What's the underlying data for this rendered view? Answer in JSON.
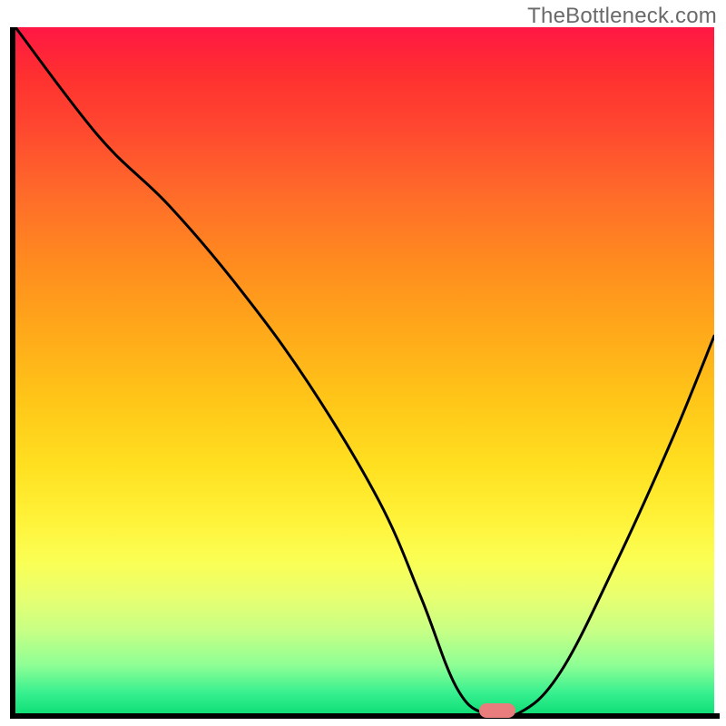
{
  "watermark": "TheBottleneck.com",
  "chart_data": {
    "type": "line",
    "title": "",
    "xlabel": "",
    "ylabel": "",
    "xlim": [
      0,
      100
    ],
    "ylim": [
      0,
      100
    ],
    "x": [
      0,
      12,
      22,
      32,
      42,
      52,
      58,
      63,
      67,
      72,
      78,
      86,
      94,
      100
    ],
    "values": [
      100,
      84,
      74,
      62,
      48,
      31,
      17,
      4,
      0,
      0,
      6,
      22,
      40,
      55
    ],
    "marker": {
      "x": 69,
      "y": 0,
      "color": "#e97c7c"
    },
    "background_gradient": {
      "top": "#ff1744",
      "middle": "#ffe020",
      "bottom": "#10df78"
    }
  }
}
